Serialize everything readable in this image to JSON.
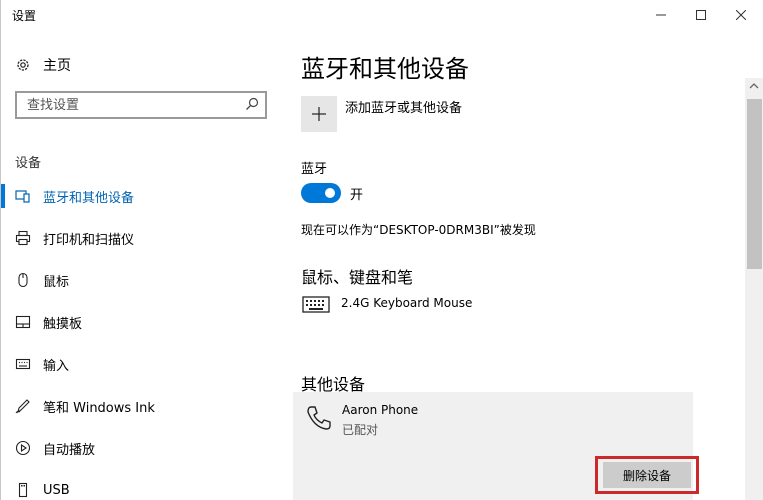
{
  "window": {
    "title": "设置"
  },
  "sidebar": {
    "home_label": "主页",
    "search_placeholder": "查找设置",
    "section_label": "设备",
    "items": [
      {
        "label": "蓝牙和其他设备",
        "icon": "bluetooth-devices-icon",
        "active": true
      },
      {
        "label": "打印机和扫描仪",
        "icon": "printer-icon"
      },
      {
        "label": "鼠标",
        "icon": "mouse-icon"
      },
      {
        "label": "触摸板",
        "icon": "touchpad-icon"
      },
      {
        "label": "输入",
        "icon": "keyboard-input-icon"
      },
      {
        "label": "笔和 Windows Ink",
        "icon": "pen-icon"
      },
      {
        "label": "自动播放",
        "icon": "autoplay-icon"
      },
      {
        "label": "USB",
        "icon": "usb-icon"
      }
    ]
  },
  "main": {
    "title": "蓝牙和其他设备",
    "add_device_label": "添加蓝牙或其他设备",
    "bluetooth": {
      "heading": "蓝牙",
      "toggle_label": "开",
      "discoverable_text": "现在可以作为“DESKTOP-0DRM3BI”被发现"
    },
    "mouse_section": {
      "heading": "鼠标、键盘和笔",
      "device_name": "2.4G Keyboard Mouse"
    },
    "other_section": {
      "heading": "其他设备",
      "device_name": "Aaron Phone",
      "device_status": "已配对",
      "remove_label": "删除设备"
    }
  },
  "colors": {
    "accent": "#0078d7",
    "highlight_outline": "#cc2a2a"
  }
}
